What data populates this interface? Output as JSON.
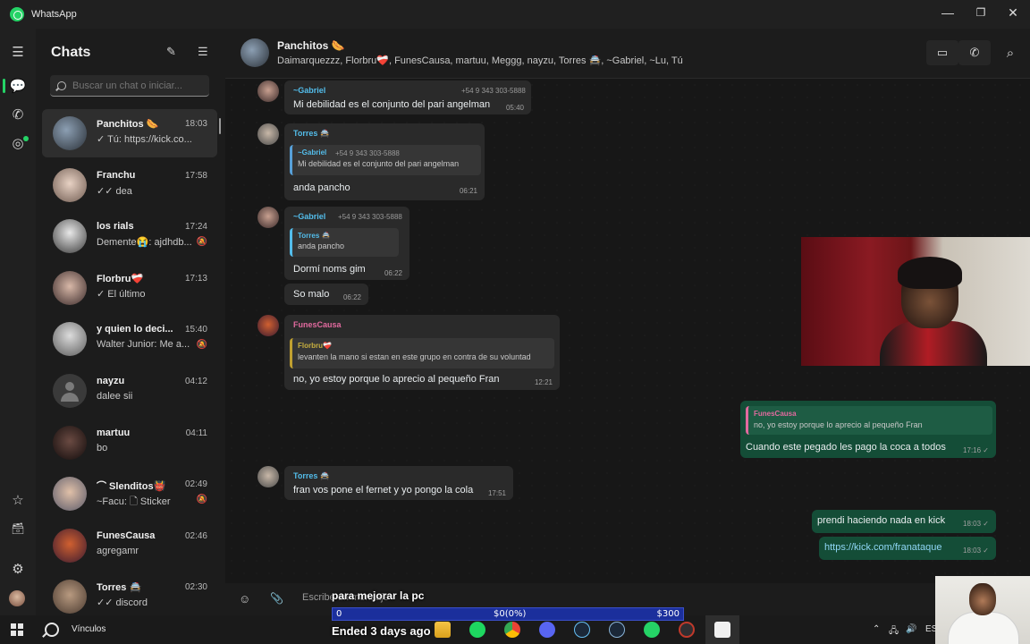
{
  "window": {
    "title": "WhatsApp",
    "controls": [
      "—",
      "❐",
      "✕"
    ]
  },
  "rail": {
    "icons": [
      "menu-icon",
      "chats-icon",
      "calls-icon",
      "status-icon",
      "starred-icon",
      "archive-icon",
      "settings-icon"
    ],
    "symbols": {
      "menu": "☰",
      "chats": "💬",
      "calls": "✆",
      "status": "◎",
      "starred": "☆",
      "archive": "🗃",
      "settings": "⚙"
    }
  },
  "chats_panel": {
    "title": "Chats",
    "new_chat_icon": "✎",
    "filter_icon": "☰",
    "search_placeholder": "Buscar un chat o iniciar...",
    "items": [
      {
        "name": "Panchitos 🌭",
        "time": "18:03",
        "preview": "✓ Tú: https://kick.co...",
        "muted": "",
        "selected": true
      },
      {
        "name": "Franchu",
        "time": "17:58",
        "preview": "✓✓ dea",
        "muted": ""
      },
      {
        "name": "los rials",
        "time": "17:24",
        "preview": "Demente😭: ajdhdb...",
        "muted": "🔕"
      },
      {
        "name": "Florbru❤️‍🩹",
        "time": "17:13",
        "preview": "✓ El último",
        "muted": ""
      },
      {
        "name": "y quien lo deci...",
        "time": "15:40",
        "preview": "Walter Junior: Me a...",
        "muted": "🔕"
      },
      {
        "name": "nayzu",
        "time": "04:12",
        "preview": "dalee sii",
        "muted": ""
      },
      {
        "name": "martuu",
        "time": "04:11",
        "preview": "bo",
        "muted": ""
      },
      {
        "name": "⌒ Slenditos👹",
        "time": "02:49",
        "preview": "~Facu: 🗋 Sticker",
        "muted": "🔕"
      },
      {
        "name": "FunesCausa",
        "time": "02:46",
        "preview": "agregamr",
        "muted": ""
      },
      {
        "name": "Torres 🚔",
        "time": "02:30",
        "preview": "✓✓ discord",
        "muted": ""
      }
    ]
  },
  "conversation": {
    "group_name": "Panchitos 🌭",
    "members": "Daimarquezzz, Florbru❤️‍🩹, FunesCausa, martuu, Meggg, nayzu, Torres 🚔, ~Gabriel, ~Lu, Tú",
    "header_icons": {
      "video": "▭",
      "call": "✆",
      "search": "⌕"
    },
    "messages": [
      {
        "sender": "~Gabriel",
        "phone": "+54 9 343 303-5888",
        "text": "Mi debilidad es el conjunto del pari angelman",
        "time": "05:40"
      },
      {
        "sender": "Torres 🚔",
        "quote_sender": "~Gabriel",
        "quote_phone": "+54 9 343 303-5888",
        "quote_text": "Mi debilidad es el conjunto del pari angelman",
        "text": "anda pancho",
        "time": "06:21"
      },
      {
        "sender": "~Gabriel",
        "phone": "+54 9 343 303-5888",
        "quote_sender": "Torres 🚔",
        "quote_text": "anda pancho",
        "text": "Dormí noms gim",
        "time": "06:22"
      },
      {
        "text": "So malo",
        "time": "06:22"
      },
      {
        "sender": "FunesCausa",
        "quote_sender": "Florbru❤️‍🩹",
        "quote_text": "levanten la mano si estan en este grupo en contra de su voluntad",
        "text": "no, yo estoy porque lo aprecio al pequeño Fran",
        "time": "12:21"
      },
      {
        "outgoing": true,
        "quote_sender": "FunesCausa",
        "quote_text": "no, yo estoy porque lo aprecio al pequeño Fran",
        "text": "Cuando este pegado les pago la coca a todos",
        "time": "17:16 ✓"
      },
      {
        "sender": "Torres 🚔",
        "text": "fran vos pone el fernet y yo pongo la cola",
        "time": "17:51"
      },
      {
        "outgoing": true,
        "text": "prendi haciendo nada en kick",
        "time": "18:03 ✓"
      },
      {
        "outgoing": true,
        "text": "https://kick.com/franataque",
        "time": "18:03 ✓"
      }
    ],
    "composer": {
      "placeholder": "Escribe un mensaje",
      "emoji_icon": "☺",
      "attach_icon": "📎"
    }
  },
  "stream_overlay": {
    "goal_title": "para mejorar la pc",
    "bar_start": "0",
    "bar_progress": "$0(0%)",
    "bar_goal": "$300",
    "progress_fraction": 0,
    "ended": "Ended 3 days ago"
  },
  "taskbar": {
    "search_label": "Vínculos",
    "apps": [
      "file-explorer-icon",
      "spotify-icon",
      "chrome-icon",
      "discord-icon",
      "steam-icon",
      "steam-alt-icon",
      "whatsapp-icon",
      "obs-icon",
      "capcut-icon"
    ],
    "lang": "ES"
  },
  "colors": {
    "accent": "#25d366",
    "outgoing_bubble": "#144d37",
    "incoming_bubble": "#2a2a2a",
    "progress_bar": "#1b2f9c"
  }
}
